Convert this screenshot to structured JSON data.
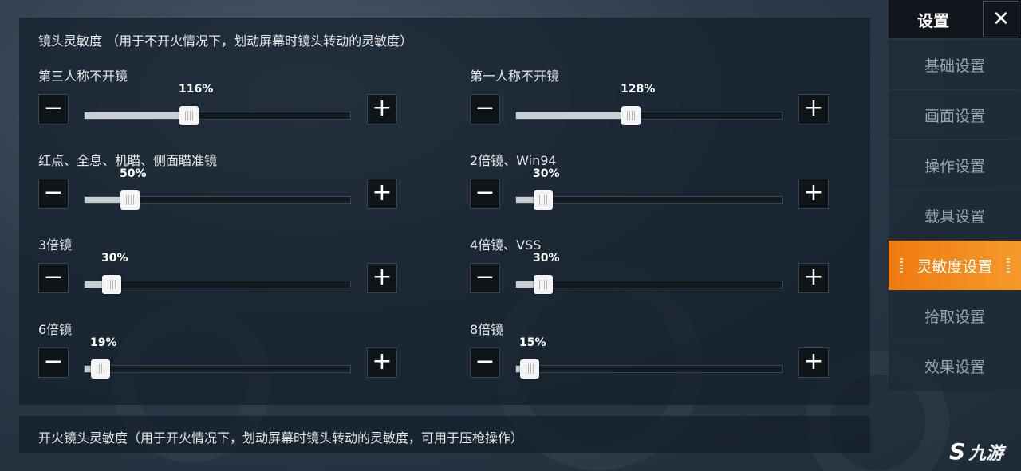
{
  "main": {
    "section_title": "镜头灵敏度 （用于不开火情况下，划动屏幕时镜头转动的灵敏度）",
    "sliders": [
      {
        "label": "第三人称不开镜",
        "value_text": "116%",
        "fraction": 0.39
      },
      {
        "label": "第一人称不开镜",
        "value_text": "128%",
        "fraction": 0.43
      },
      {
        "label": "红点、全息、机瞄、侧面瞄准镜",
        "value_text": "50%",
        "fraction": 0.17
      },
      {
        "label": "2倍镜、Win94",
        "value_text": "30%",
        "fraction": 0.1
      },
      {
        "label": "3倍镜",
        "value_text": "30%",
        "fraction": 0.1
      },
      {
        "label": "4倍镜、VSS",
        "value_text": "30%",
        "fraction": 0.1
      },
      {
        "label": "6倍镜",
        "value_text": "19%",
        "fraction": 0.06
      },
      {
        "label": "8倍镜",
        "value_text": "15%",
        "fraction": 0.05
      }
    ],
    "minus_symbol": "−",
    "plus_symbol": "+"
  },
  "bottom": {
    "text": "开火镜头灵敏度（用于开火情况下，划动屏幕时镜头转动的灵敏度，可用于压枪操作）"
  },
  "sidebar": {
    "title": "设置",
    "close_symbol": "✕",
    "items": [
      {
        "label": "基础设置",
        "active": false
      },
      {
        "label": "画面设置",
        "active": false
      },
      {
        "label": "操作设置",
        "active": false
      },
      {
        "label": "载具设置",
        "active": false
      },
      {
        "label": "灵敏度设置",
        "active": true
      },
      {
        "label": "拾取设置",
        "active": false
      },
      {
        "label": "效果设置",
        "active": false
      }
    ]
  },
  "watermark": {
    "logo": "S",
    "text": "九游"
  },
  "colors": {
    "accent": "#f07a10",
    "panel": "#141e2a"
  }
}
